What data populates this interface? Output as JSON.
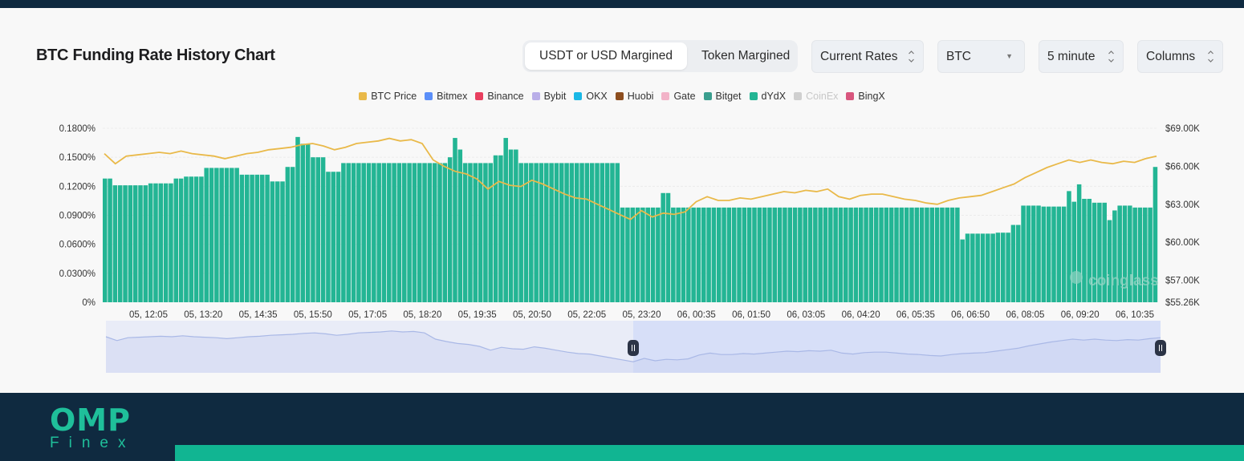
{
  "header": {
    "title": "BTC Funding Rate History Chart",
    "margin_tabs": [
      {
        "label": "USDT or USD Margined",
        "active": true
      },
      {
        "label": "Token Margined",
        "active": false
      }
    ],
    "selects": {
      "rate_type": "Current Rates",
      "symbol": "BTC",
      "interval": "5 minute",
      "chart_style": "Columns"
    }
  },
  "legend": [
    {
      "label": "BTC Price",
      "color": "#e9b949",
      "enabled": true
    },
    {
      "label": "Bitmex",
      "color": "#5b8ff9",
      "enabled": true
    },
    {
      "label": "Binance",
      "color": "#e8405f",
      "enabled": true
    },
    {
      "label": "Bybit",
      "color": "#b9aee8",
      "enabled": true
    },
    {
      "label": "OKX",
      "color": "#1ab8e6",
      "enabled": true
    },
    {
      "label": "Huobi",
      "color": "#8d4e1f",
      "enabled": true
    },
    {
      "label": "Gate",
      "color": "#f2b3c8",
      "enabled": true
    },
    {
      "label": "Bitget",
      "color": "#3a9e8e",
      "enabled": true
    },
    {
      "label": "dYdX",
      "color": "#23b594",
      "enabled": true
    },
    {
      "label": "CoinEx",
      "color": "#cfcfcf",
      "enabled": false
    },
    {
      "label": "BingX",
      "color": "#d8567e",
      "enabled": true
    }
  ],
  "watermark": "coinglass",
  "chart_data": {
    "type": "bar",
    "title": "BTC Funding Rate History Chart",
    "series_bar_name": "dYdX",
    "series_line_name": "BTC Price",
    "x_ticks": [
      "05, 12:05",
      "05, 13:20",
      "05, 14:35",
      "05, 15:50",
      "05, 17:05",
      "05, 18:20",
      "05, 19:35",
      "05, 20:50",
      "05, 22:05",
      "05, 23:20",
      "06, 00:35",
      "06, 01:50",
      "06, 03:05",
      "06, 04:20",
      "06, 05:35",
      "06, 06:50",
      "06, 08:05",
      "06, 09:20",
      "06, 10:35"
    ],
    "y_left_ticks": [
      "0%",
      "0.0300%",
      "0.0600%",
      "0.0900%",
      "0.1200%",
      "0.1500%",
      "0.1800%"
    ],
    "y_left_range": [
      0,
      0.18
    ],
    "y_right_ticks": [
      "$55.26K",
      "$57.00K",
      "$60.00K",
      "$63.00K",
      "$66.00K",
      "$69.00K"
    ],
    "y_right_range": [
      55.26,
      69.0
    ],
    "grid": true,
    "legend_position": "top",
    "funding_rate_segments": [
      {
        "from": 0,
        "to": 2,
        "value": 0.128
      },
      {
        "from": 2,
        "to": 9,
        "value": 0.121
      },
      {
        "from": 9,
        "to": 14,
        "value": 0.123
      },
      {
        "from": 14,
        "to": 16,
        "value": 0.128
      },
      {
        "from": 16,
        "to": 20,
        "value": 0.13
      },
      {
        "from": 20,
        "to": 27,
        "value": 0.139
      },
      {
        "from": 27,
        "to": 33,
        "value": 0.132
      },
      {
        "from": 33,
        "to": 36,
        "value": 0.125
      },
      {
        "from": 36,
        "to": 38,
        "value": 0.14
      },
      {
        "from": 38,
        "to": 39,
        "value": 0.171
      },
      {
        "from": 39,
        "to": 41,
        "value": 0.164
      },
      {
        "from": 41,
        "to": 44,
        "value": 0.15
      },
      {
        "from": 44,
        "to": 47,
        "value": 0.135
      },
      {
        "from": 47,
        "to": 68,
        "value": 0.144
      },
      {
        "from": 68,
        "to": 69,
        "value": 0.15
      },
      {
        "from": 69,
        "to": 70,
        "value": 0.17
      },
      {
        "from": 70,
        "to": 71,
        "value": 0.158
      },
      {
        "from": 71,
        "to": 77,
        "value": 0.144
      },
      {
        "from": 77,
        "to": 79,
        "value": 0.152
      },
      {
        "from": 79,
        "to": 80,
        "value": 0.17
      },
      {
        "from": 80,
        "to": 82,
        "value": 0.158
      },
      {
        "from": 82,
        "to": 102,
        "value": 0.144
      },
      {
        "from": 102,
        "to": 110,
        "value": 0.098
      },
      {
        "from": 110,
        "to": 112,
        "value": 0.113
      },
      {
        "from": 112,
        "to": 169,
        "value": 0.098
      },
      {
        "from": 169,
        "to": 170,
        "value": 0.065
      },
      {
        "from": 170,
        "to": 176,
        "value": 0.071
      },
      {
        "from": 176,
        "to": 179,
        "value": 0.072
      },
      {
        "from": 179,
        "to": 181,
        "value": 0.08
      },
      {
        "from": 181,
        "to": 185,
        "value": 0.1
      },
      {
        "from": 185,
        "to": 190,
        "value": 0.099
      },
      {
        "from": 190,
        "to": 191,
        "value": 0.115
      },
      {
        "from": 191,
        "to": 192,
        "value": 0.104
      },
      {
        "from": 192,
        "to": 193,
        "value": 0.122
      },
      {
        "from": 193,
        "to": 195,
        "value": 0.107
      },
      {
        "from": 195,
        "to": 198,
        "value": 0.103
      },
      {
        "from": 198,
        "to": 199,
        "value": 0.085
      },
      {
        "from": 199,
        "to": 200,
        "value": 0.095
      },
      {
        "from": 200,
        "to": 203,
        "value": 0.1
      },
      {
        "from": 203,
        "to": 207,
        "value": 0.098
      },
      {
        "from": 207,
        "to": 208,
        "value": 0.14
      }
    ],
    "btc_price_k": [
      67.0,
      66.2,
      66.8,
      66.9,
      67.0,
      67.1,
      67.0,
      67.2,
      67.0,
      66.9,
      66.8,
      66.6,
      66.8,
      67.0,
      67.1,
      67.3,
      67.4,
      67.5,
      67.7,
      67.8,
      67.6,
      67.3,
      67.5,
      67.8,
      67.9,
      68.0,
      68.2,
      68.0,
      68.1,
      67.8,
      66.5,
      66.0,
      65.6,
      65.4,
      65.0,
      64.2,
      64.8,
      64.5,
      64.4,
      64.9,
      64.6,
      64.2,
      63.8,
      63.5,
      63.4,
      63.0,
      62.6,
      62.2,
      61.8,
      62.5,
      62.0,
      62.3,
      62.2,
      62.4,
      63.2,
      63.6,
      63.3,
      63.3,
      63.5,
      63.4,
      63.6,
      63.8,
      64.0,
      63.9,
      64.1,
      64.0,
      64.2,
      63.6,
      63.4,
      63.7,
      63.8,
      63.8,
      63.6,
      63.4,
      63.3,
      63.1,
      63.0,
      63.3,
      63.5,
      63.6,
      63.7,
      64.0,
      64.3,
      64.6,
      65.1,
      65.5,
      65.9,
      66.2,
      66.5,
      66.3,
      66.5,
      66.3,
      66.2,
      66.4,
      66.3,
      66.6,
      66.8
    ]
  },
  "navigator": {
    "range_start_fraction": 0.5,
    "range_end_fraction": 1.0
  },
  "footer": {
    "logo_top": "OMP",
    "logo_bottom": "Finex"
  }
}
